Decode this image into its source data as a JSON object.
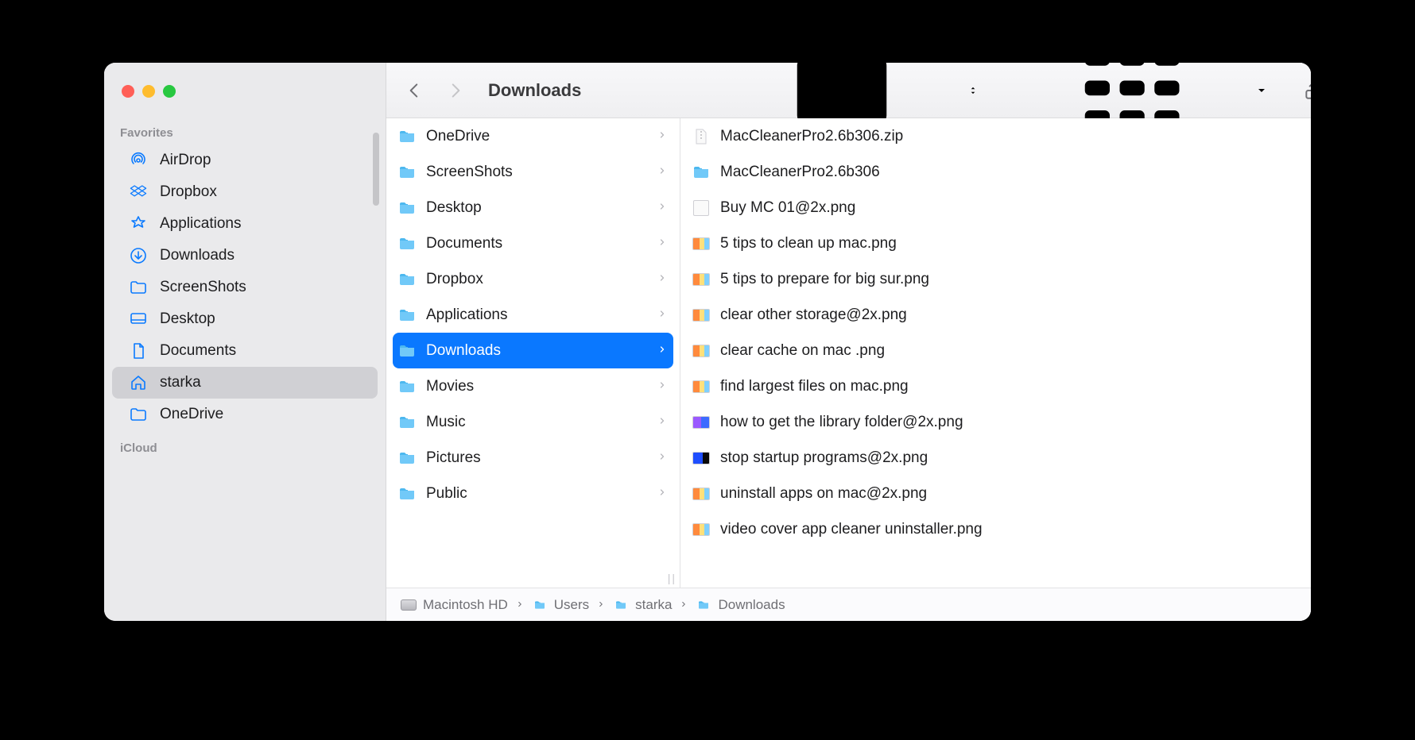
{
  "window": {
    "title": "Downloads"
  },
  "sidebar": {
    "sections": [
      {
        "label": "Favorites",
        "items": [
          {
            "icon": "airdrop",
            "label": "AirDrop",
            "selected": false
          },
          {
            "icon": "dropbox",
            "label": "Dropbox",
            "selected": false
          },
          {
            "icon": "appstore",
            "label": "Applications",
            "selected": false
          },
          {
            "icon": "download",
            "label": "Downloads",
            "selected": false
          },
          {
            "icon": "folder",
            "label": "ScreenShots",
            "selected": false
          },
          {
            "icon": "desktop",
            "label": "Desktop",
            "selected": false
          },
          {
            "icon": "document",
            "label": "Documents",
            "selected": false
          },
          {
            "icon": "home",
            "label": "starka",
            "selected": true
          },
          {
            "icon": "folder",
            "label": "OneDrive",
            "selected": false
          }
        ]
      },
      {
        "label": "iCloud",
        "items": []
      }
    ]
  },
  "columns": [
    {
      "items": [
        {
          "kind": "folder",
          "name": "OneDrive",
          "hasChildren": true
        },
        {
          "kind": "folder",
          "name": "ScreenShots",
          "hasChildren": true
        },
        {
          "kind": "folder-desktop",
          "name": "Desktop",
          "hasChildren": true
        },
        {
          "kind": "folder",
          "name": "Documents",
          "hasChildren": true
        },
        {
          "kind": "folder-dropbox",
          "name": "Dropbox",
          "hasChildren": true
        },
        {
          "kind": "folder-apps",
          "name": "Applications",
          "hasChildren": true
        },
        {
          "kind": "folder-down",
          "name": "Downloads",
          "hasChildren": true,
          "selected": true
        },
        {
          "kind": "folder-movies",
          "name": "Movies",
          "hasChildren": true
        },
        {
          "kind": "folder-music",
          "name": "Music",
          "hasChildren": true
        },
        {
          "kind": "folder-pictures",
          "name": "Pictures",
          "hasChildren": true
        },
        {
          "kind": "folder-public",
          "name": "Public",
          "hasChildren": true
        }
      ]
    },
    {
      "items": [
        {
          "kind": "zip",
          "name": "MacCleanerPro2.6b306.zip"
        },
        {
          "kind": "folder",
          "name": "MacCleanerPro2.6b306",
          "hasChildren": true
        },
        {
          "kind": "png",
          "name": "Buy MC 01@2x.png",
          "thumb": "plain"
        },
        {
          "kind": "png",
          "name": "5 tips to clean up mac.png"
        },
        {
          "kind": "png",
          "name": "5 tips to prepare for big sur.png"
        },
        {
          "kind": "png",
          "name": "clear other storage@2x.png"
        },
        {
          "kind": "png",
          "name": "clear cache on mac .png"
        },
        {
          "kind": "png",
          "name": "find largest files on mac.png"
        },
        {
          "kind": "png",
          "name": "how to get the library folder@2x.png",
          "thumb": "v2"
        },
        {
          "kind": "png",
          "name": "stop startup programs@2x.png",
          "thumb": "v3"
        },
        {
          "kind": "png",
          "name": "uninstall apps on mac@2x.png"
        },
        {
          "kind": "png",
          "name": "video cover app cleaner uninstaller.png"
        }
      ],
      "scroll": true
    }
  ],
  "pathbar": [
    {
      "icon": "hd",
      "label": "Macintosh HD"
    },
    {
      "icon": "folder",
      "label": "Users"
    },
    {
      "icon": "folder",
      "label": "starka"
    },
    {
      "icon": "folder",
      "label": "Downloads"
    }
  ]
}
